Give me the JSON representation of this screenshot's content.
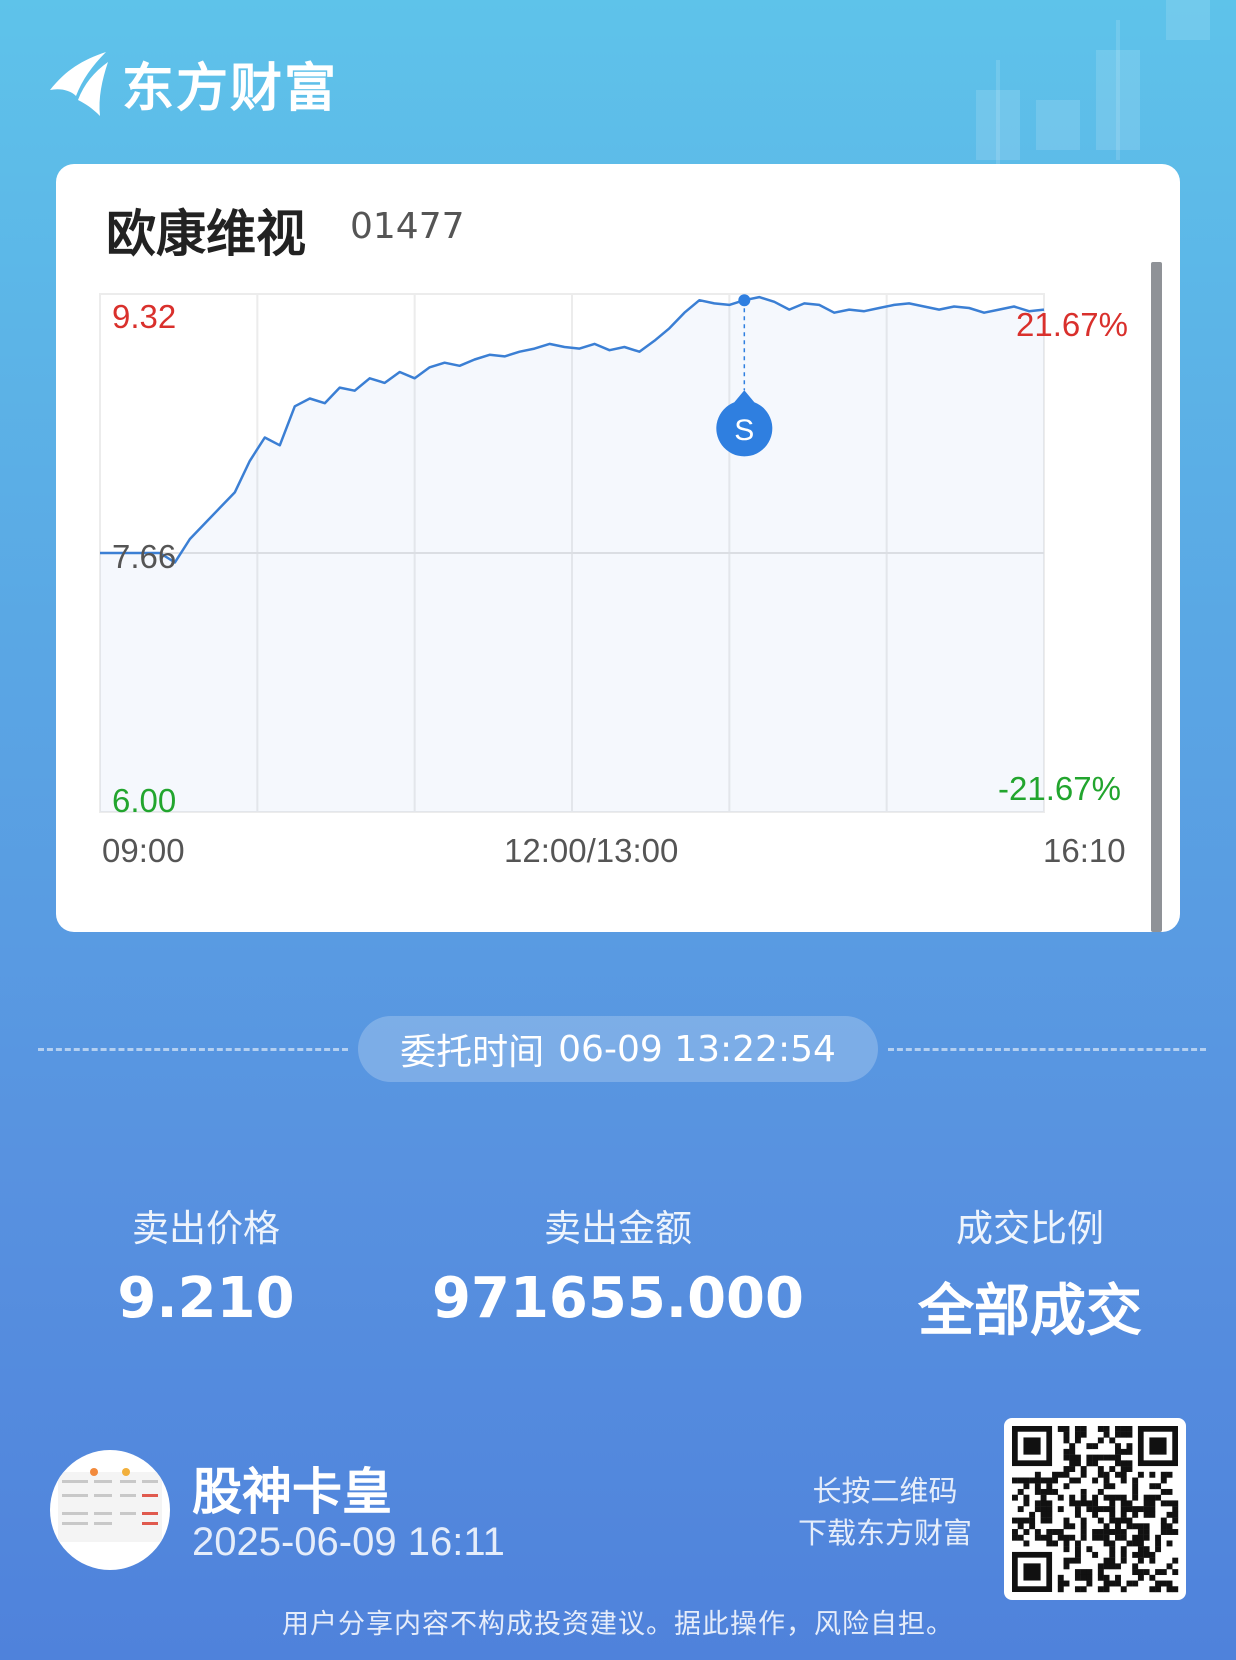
{
  "app": {
    "brand": "东方财富"
  },
  "stock": {
    "name": "欧康维视",
    "code": "01477"
  },
  "chart_data": {
    "type": "line",
    "title": "",
    "y_max_label": "9.32",
    "y_mid_label": "7.66",
    "y_min_label": "6.00",
    "pct_max_label": "21.67%",
    "pct_min_label": "-21.67%",
    "x_labels": [
      "09:00",
      "12:00/13:00",
      "16:10"
    ],
    "ylim": [
      6.0,
      9.32
    ],
    "prev_close": 7.66,
    "series": [
      {
        "values": [
          7.66,
          7.66,
          7.66,
          7.66,
          7.66,
          7.6,
          7.75,
          7.85,
          7.95,
          8.05,
          8.25,
          8.4,
          8.35,
          8.6,
          8.65,
          8.62,
          8.72,
          8.7,
          8.78,
          8.75,
          8.82,
          8.78,
          8.85,
          8.88,
          8.86,
          8.9,
          8.93,
          8.92,
          8.95,
          8.97,
          9.0,
          8.98,
          8.97,
          9.0,
          8.96,
          8.98,
          8.95,
          9.02,
          9.1,
          9.2,
          9.28,
          9.26,
          9.25,
          9.28,
          9.3,
          9.27,
          9.22,
          9.26,
          9.25,
          9.2,
          9.22,
          9.21,
          9.23,
          9.25,
          9.26,
          9.24,
          9.22,
          9.24,
          9.23,
          9.2,
          9.22,
          9.24,
          9.21,
          9.22
        ]
      }
    ],
    "marker": {
      "label": "S",
      "time": "13:22:54",
      "price": 9.21
    }
  },
  "order": {
    "time_label": "委托时间",
    "time_value": "06-09 13:22:54"
  },
  "stats": [
    {
      "label": "卖出价格",
      "value": "9.210"
    },
    {
      "label": "卖出金额",
      "value": "971655.000"
    },
    {
      "label": "成交比例",
      "value": "全部成交"
    }
  ],
  "footer": {
    "user_name": "股神卡皇",
    "share_time": "2025-06-09 16:11",
    "qr_hint_line1": "长按二维码",
    "qr_hint_line2": "下载东方财富",
    "disclaimer": "用户分享内容不构成投资建议。据此操作，风险自担。"
  },
  "colors": {
    "line": "#3b7fd4",
    "up": "#d9302c",
    "down": "#22a52e",
    "marker": "#2f7fe0"
  }
}
